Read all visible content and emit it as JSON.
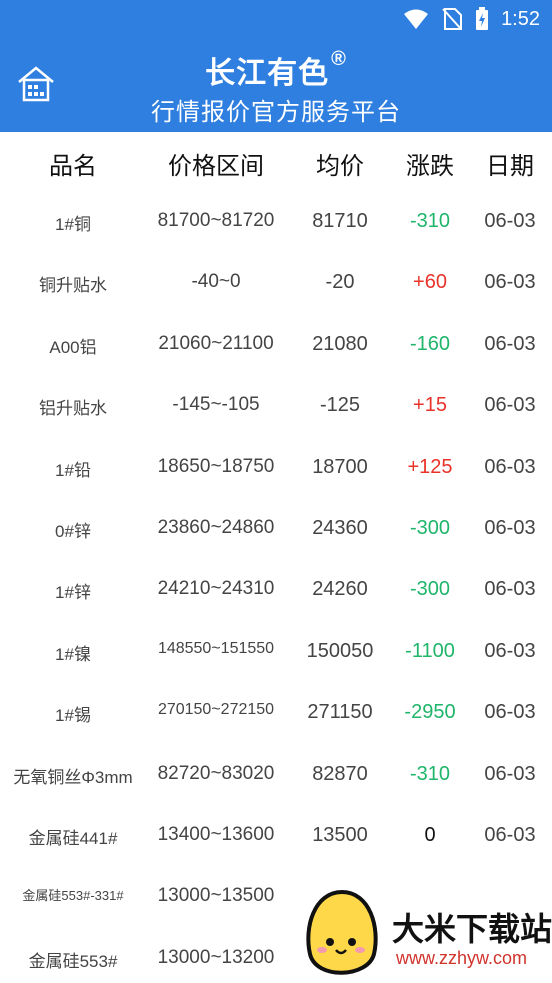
{
  "status": {
    "time": "1:52"
  },
  "header": {
    "title": "长江有色",
    "reg": "®",
    "subtitle": "行情报价官方服务平台"
  },
  "table": {
    "columns": [
      "品名",
      "价格区间",
      "均价",
      "涨跌",
      "日期"
    ],
    "rows": [
      {
        "name": "1#铜",
        "range": "81700~81720",
        "avg": "81710",
        "change": "-310",
        "date": "06-03"
      },
      {
        "name": "铜升贴水",
        "range": "-40~0",
        "avg": "-20",
        "change": "+60",
        "date": "06-03"
      },
      {
        "name": "A00铝",
        "range": "21060~21100",
        "avg": "21080",
        "change": "-160",
        "date": "06-03"
      },
      {
        "name": "铝升贴水",
        "range": "-145~-105",
        "avg": "-125",
        "change": "+15",
        "date": "06-03"
      },
      {
        "name": "1#铅",
        "range": "18650~18750",
        "avg": "18700",
        "change": "+125",
        "date": "06-03"
      },
      {
        "name": "0#锌",
        "range": "23860~24860",
        "avg": "24360",
        "change": "-300",
        "date": "06-03"
      },
      {
        "name": "1#锌",
        "range": "24210~24310",
        "avg": "24260",
        "change": "-300",
        "date": "06-03"
      },
      {
        "name": "1#镍",
        "range": "148550~151550",
        "avg": "150050",
        "change": "-1100",
        "date": "06-03"
      },
      {
        "name": "1#锡",
        "range": "270150~272150",
        "avg": "271150",
        "change": "-2950",
        "date": "06-03"
      },
      {
        "name": "无氧铜丝Φ3mm",
        "range": "82720~83020",
        "avg": "82870",
        "change": "-310",
        "date": "06-03"
      },
      {
        "name": "金属硅441#",
        "range": "13400~13600",
        "avg": "13500",
        "change": "0",
        "date": "06-03"
      },
      {
        "name": "金属硅553#-331#",
        "range": "13000~13500",
        "avg": "",
        "change": "",
        "date": ""
      },
      {
        "name": "金属硅553#",
        "range": "13000~13200",
        "avg": "",
        "change": "",
        "date": ""
      }
    ]
  },
  "watermark": {
    "text": "大米下载站",
    "url": "www.zzhyw.com"
  },
  "colors": {
    "brand": "#2f7fe0",
    "down": "#1fb56a",
    "up": "#e8332a"
  }
}
